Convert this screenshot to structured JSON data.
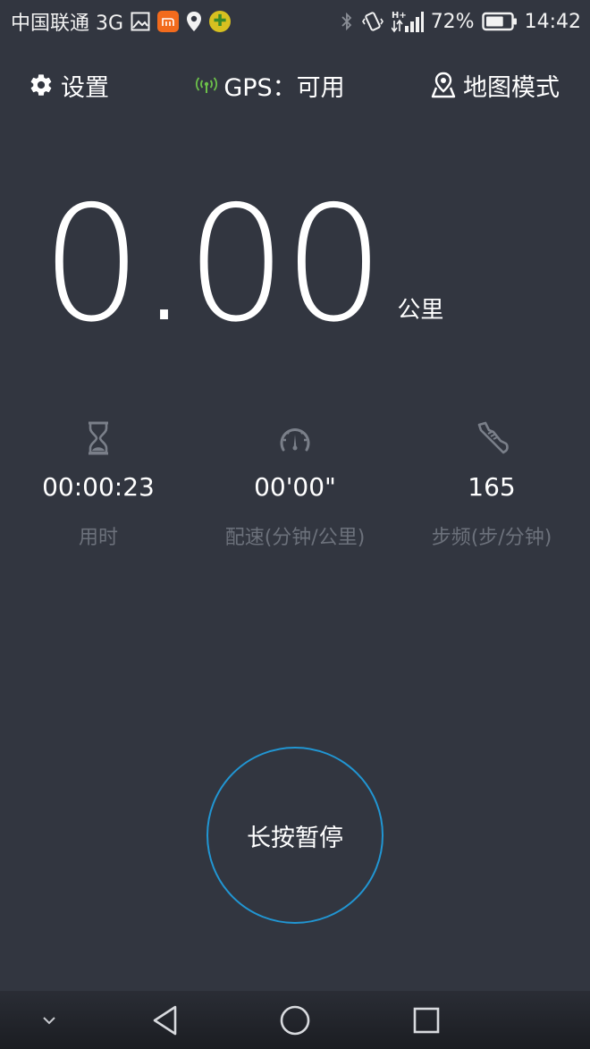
{
  "status_bar": {
    "carrier": "中国联通 3G",
    "network_type": "H+",
    "battery_percent": "72%",
    "time": "14:42",
    "battery_level": 0.72,
    "icons": [
      "image-icon",
      "mi-app-icon",
      "location-pin-icon",
      "plus-app-icon",
      "bluetooth-icon",
      "vibrate-icon",
      "signal-icon",
      "battery-icon"
    ]
  },
  "top_bar": {
    "settings_label": "设置",
    "gps_label": "GPS：可用",
    "map_mode_label": "地图模式",
    "gps_color": "#6cc04a"
  },
  "distance": {
    "value": "0.00",
    "unit": "公里"
  },
  "stats": [
    {
      "icon": "hourglass-icon",
      "value": "00:00:23",
      "label": "用时"
    },
    {
      "icon": "speedometer-icon",
      "value": "00'00\"",
      "label": "配速(分钟/公里)"
    },
    {
      "icon": "shoe-icon",
      "value": "165",
      "label": "步频(步/分钟)"
    }
  ],
  "pause_button": {
    "label": "长按暂停",
    "ring_color": "#2196d3"
  },
  "nav_bar": {
    "icons": [
      "chevron-down-icon",
      "back-icon",
      "home-icon",
      "recents-icon"
    ]
  }
}
